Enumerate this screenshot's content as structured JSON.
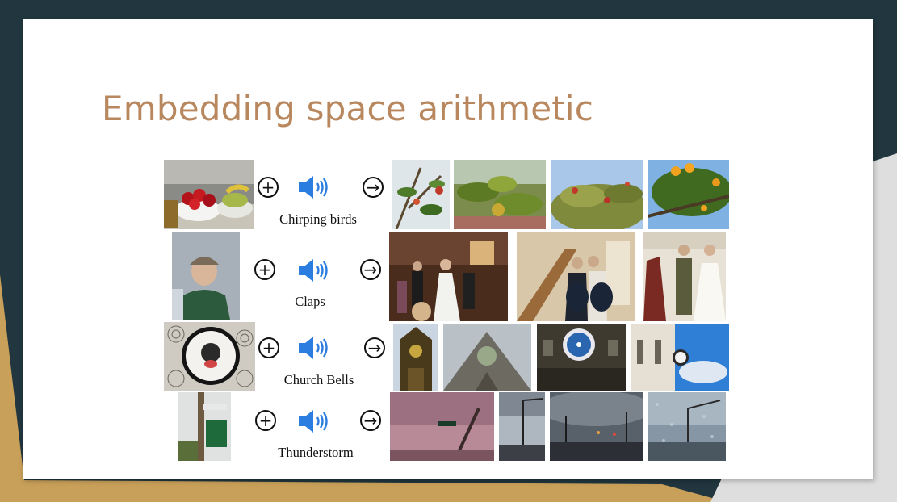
{
  "slide": {
    "title": "Embedding space arithmetic",
    "colors": {
      "title": "#b8875e",
      "dark_bg": "#21363f",
      "gold_bg": "#c8a05a",
      "speaker": "#2b7de0"
    }
  },
  "operators": {
    "plus": "+",
    "equals": "→"
  },
  "rows": [
    {
      "label": "Chirping birds",
      "query_image": "bowl-of-fruit-image",
      "results": [
        "apple-tree-branch-image",
        "fruit-tree-leaves-image",
        "red-fruit-tree-image",
        "orange-tree-image"
      ]
    },
    {
      "label": "Claps",
      "query_image": "person-portrait-image",
      "results": [
        "wedding-ceremony-image",
        "couple-on-chairs-image",
        "bride-and-groom-image"
      ]
    },
    {
      "label": "Church Bells",
      "query_image": "wall-clock-image",
      "results": [
        "church-tower-image",
        "church-roof-image",
        "building-clock-image",
        "clock-tower-sky-image"
      ]
    },
    {
      "label": "Thunderstorm",
      "query_image": "street-sign-image",
      "results": [
        "stormy-street-sign-image",
        "dark-sky-road-image",
        "cloudy-intersection-image",
        "rainy-window-image"
      ]
    }
  ]
}
